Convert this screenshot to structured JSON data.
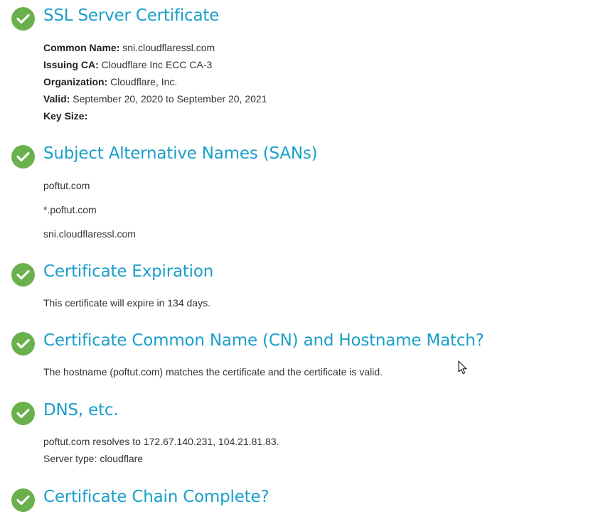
{
  "sections": [
    {
      "title": "SSL Server Certificate",
      "fields": [
        {
          "label": "Common Name:",
          "value": "sni.cloudflaressl.com"
        },
        {
          "label": "Issuing CA:",
          "value": "Cloudflare Inc ECC CA-3"
        },
        {
          "label": "Organization:",
          "value": "Cloudflare, Inc."
        },
        {
          "label": "Valid:",
          "value": "September 20, 2020 to September 20, 2021"
        },
        {
          "label": "Key Size:",
          "value": ""
        }
      ]
    },
    {
      "title": "Subject Alternative Names (SANs)",
      "names": [
        "poftut.com",
        "*.poftut.com",
        "sni.cloudflaressl.com"
      ]
    },
    {
      "title": "Certificate Expiration",
      "text": "This certificate will expire in 134 days."
    },
    {
      "title": "Certificate Common Name (CN) and Hostname Match?",
      "text": "The hostname (poftut.com) matches the certificate and the certificate is valid."
    },
    {
      "title": "DNS, etc.",
      "lines": [
        "poftut.com resolves to 172.67.140.231, 104.21.81.83.",
        "Server type: cloudflare"
      ]
    },
    {
      "title": "Certificate Chain Complete?"
    }
  ],
  "colors": {
    "heading": "#1a9fc9",
    "check_background": "#6ab04c",
    "text": "#333333"
  },
  "icons": {
    "status": "check-circle-icon",
    "pointer": "mouse-cursor-icon"
  }
}
